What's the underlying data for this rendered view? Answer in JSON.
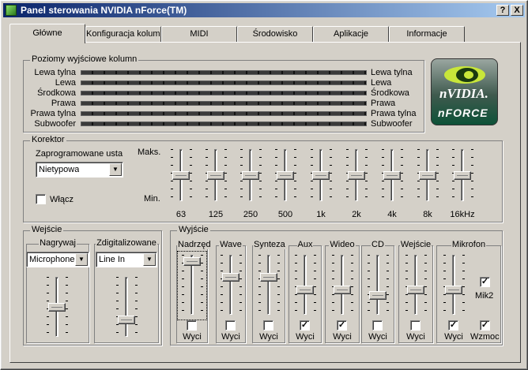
{
  "window": {
    "title": "Panel sterowania NVIDIA nForce(TM)",
    "help_btn": "?",
    "close_btn": "X"
  },
  "tabs": [
    "Główne",
    "Konfiguracja kolumn",
    "MIDI",
    "Środowisko",
    "Aplikacje",
    "Informacje"
  ],
  "output": {
    "label": "Poziomy wyjściowe kolumn",
    "channels": [
      "Lewa tylna",
      "Lewa",
      "Środkowa",
      "Prawa",
      "Prawa tylna",
      "Subwoofer"
    ]
  },
  "logo": {
    "brand": "nVIDIA.",
    "product": "nFORCE"
  },
  "eq": {
    "label": "Korektor",
    "preset_label": "Zaprogramowane usta",
    "preset_value": "Nietypowa",
    "enable_label": "Włącz",
    "enabled": false,
    "max_label": "Maks.",
    "min_label": "Min.",
    "bands": [
      "63",
      "125",
      "250",
      "500",
      "1k",
      "2k",
      "4k",
      "8k",
      "16kHz"
    ],
    "levels": [
      0.5,
      0.5,
      0.5,
      0.5,
      0.5,
      0.5,
      0.5,
      0.5,
      0.5
    ]
  },
  "input": {
    "label": "Wejście",
    "record_label": "Nagrywaj",
    "record_value": "Microphone",
    "digital_label": "Zdigitalizowane",
    "digital_value": "Line In",
    "record_level": 0.5,
    "digital_level": 0.25
  },
  "output_mix": {
    "label": "Wyjście",
    "mute_label": "Wyci",
    "boost_label": "Wzmoc",
    "mic2_label": "Mik2",
    "mic2_checked": true,
    "boost_checked": true,
    "channels": [
      {
        "name": "Nadrzęd",
        "level": 0.95,
        "muted": false
      },
      {
        "name": "Wave",
        "level": 0.65,
        "muted": false
      },
      {
        "name": "Synteza",
        "level": 0.65,
        "muted": false
      },
      {
        "name": "Aux",
        "level": 0.4,
        "muted": true
      },
      {
        "name": "Wideo",
        "level": 0.4,
        "muted": true
      },
      {
        "name": "CD",
        "level": 0.3,
        "muted": false
      },
      {
        "name": "Wejście",
        "level": 0.4,
        "muted": false
      },
      {
        "name": "Mikrofon",
        "level": 0.4,
        "muted": true
      }
    ]
  }
}
